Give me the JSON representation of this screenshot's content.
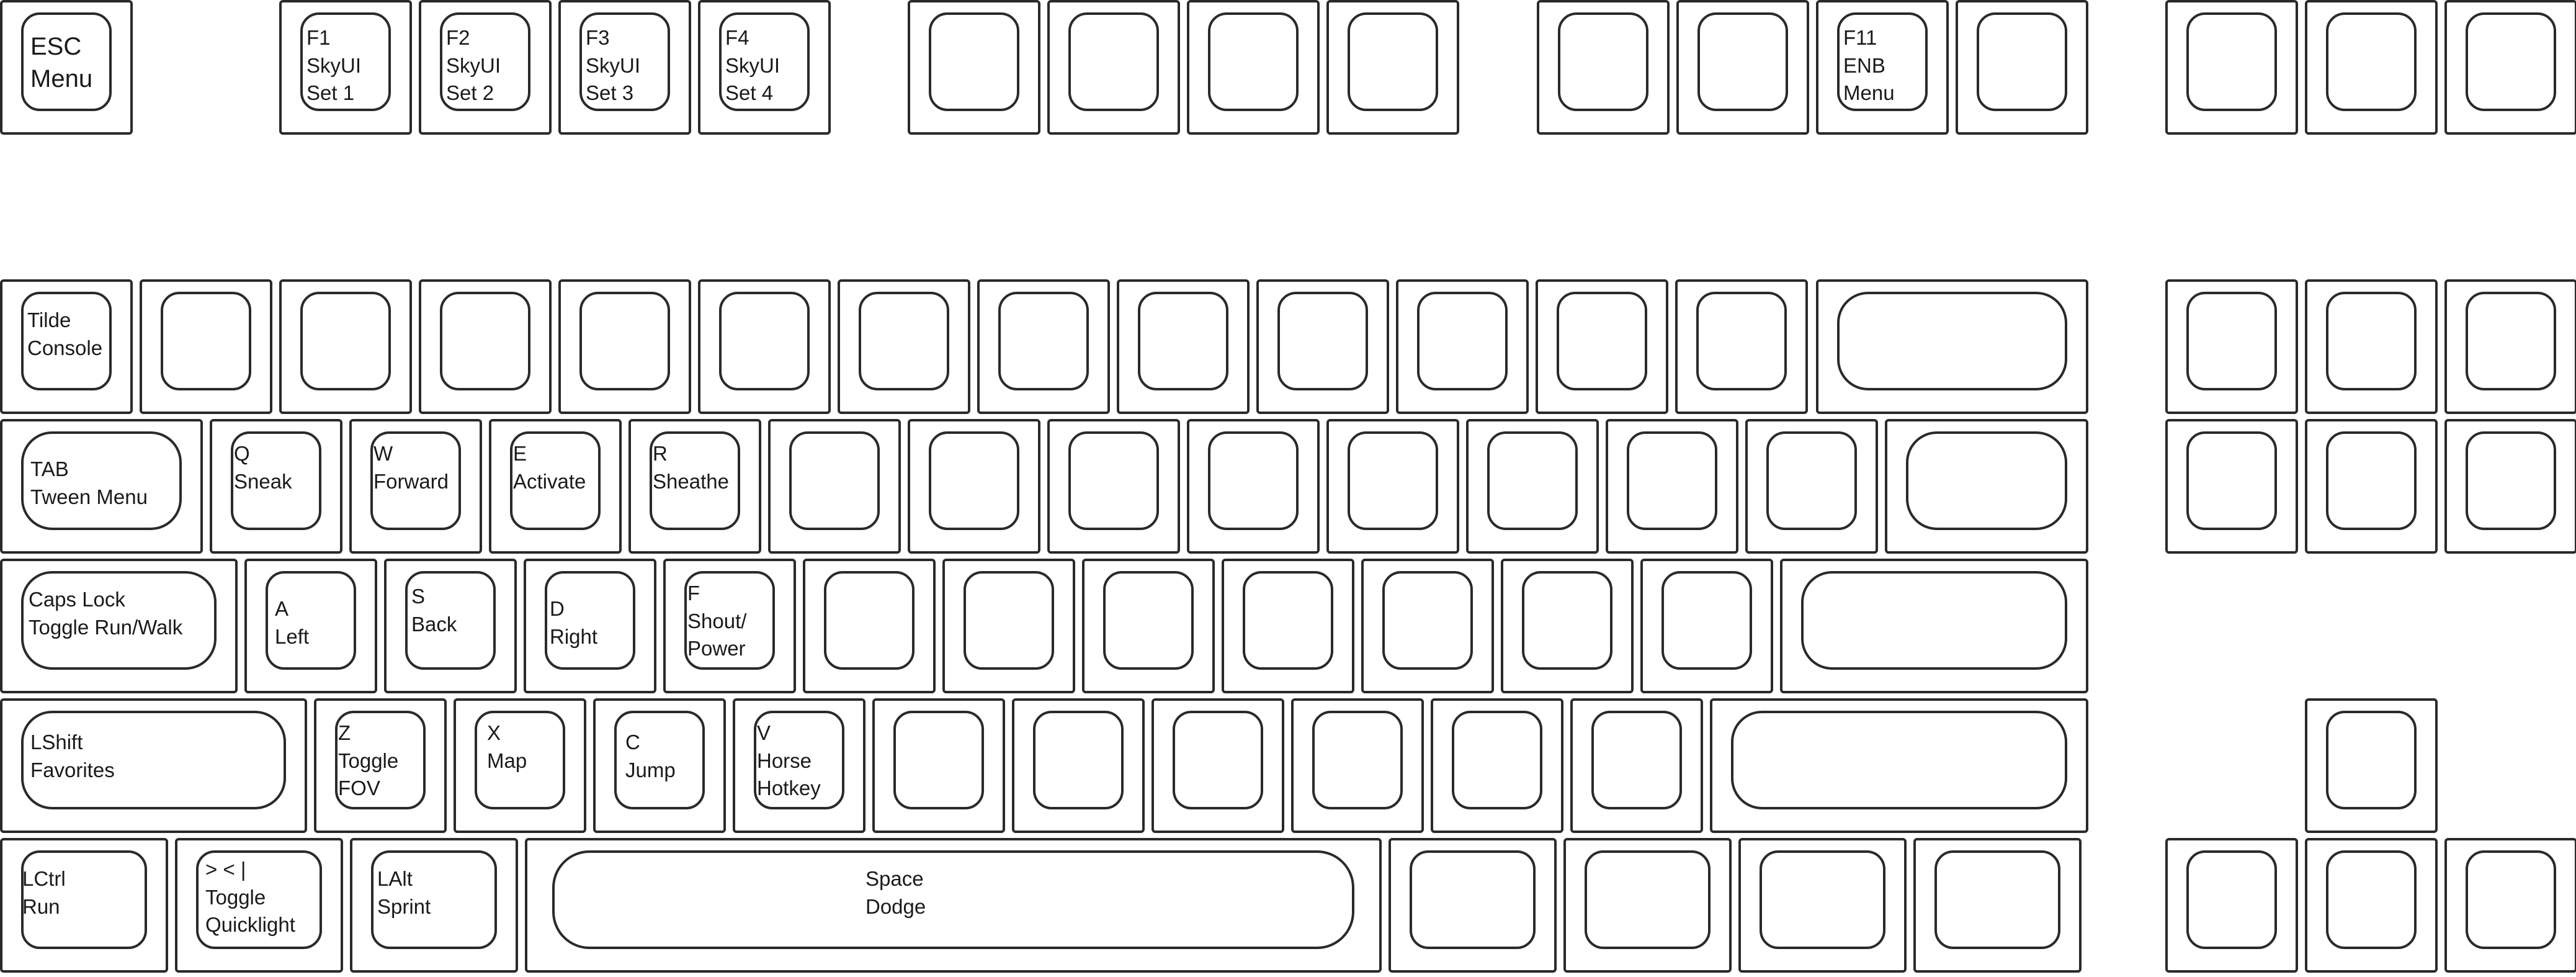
{
  "keys": {
    "esc": "ESC\nMenu",
    "f1": "F1\nSkyUI\nSet 1",
    "f2": "F2\nSkyUI\nSet 2",
    "f3": "F3\nSkyUI\nSet 3",
    "f4": "F4\nSkyUI\nSet 4",
    "f11": "F11\nENB\nMenu",
    "tilde": "Tilde\nConsole",
    "tab": "TAB\nTween Menu",
    "q": "Q\nSneak",
    "w": "W\nForward",
    "e": "E\nActivate",
    "r": "R\nSheathe",
    "capslock": "Caps Lock\nToggle Run/Walk",
    "a": "A\nLeft",
    "s": "S\nBack",
    "d": "D\nRight",
    "f": "F\nShout/\nPower",
    "lshift": "LShift\nFavorites",
    "z": "Z\nToggle\nFOV",
    "x": "X\nMap",
    "c": "C\nJump",
    "v": "V\nHorse\nHotkey",
    "lctrl": "LCtrl\nRun",
    "angle": "> < |\nToggle\nQuicklight",
    "lalt": "LAlt\nSprint",
    "space": "Space\nDodge"
  }
}
